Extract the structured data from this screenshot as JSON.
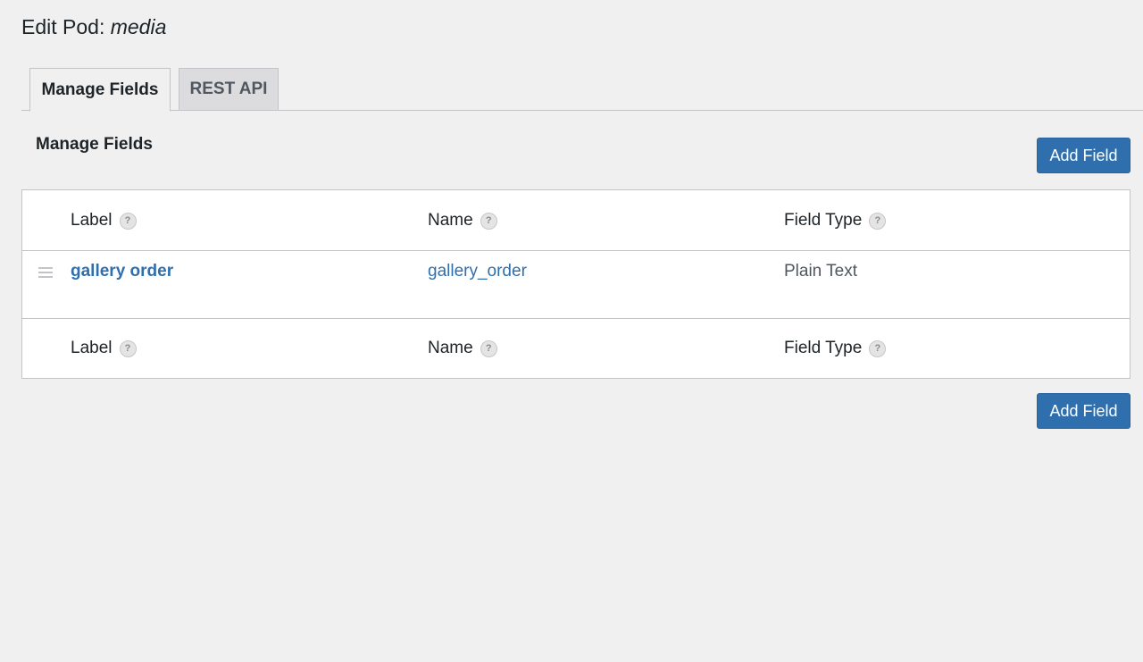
{
  "header": {
    "title_prefix": "Edit Pod:",
    "pod_name": "media"
  },
  "tabs": [
    {
      "label": "Manage Fields",
      "active": true
    },
    {
      "label": "REST API",
      "active": false
    }
  ],
  "section": {
    "title": "Manage Fields",
    "add_button_label": "Add Field"
  },
  "table": {
    "columns": [
      "Label",
      "Name",
      "Field Type"
    ],
    "help_glyph": "?",
    "rows": [
      {
        "label": "gallery order",
        "name": "gallery_order",
        "type": "Plain Text"
      }
    ]
  },
  "colors": {
    "primary": "#2f6fae",
    "background": "#f0f0f1",
    "border": "#c3c4c7"
  },
  "icons": {
    "help": "help-icon",
    "drag": "drag-handle-icon"
  }
}
